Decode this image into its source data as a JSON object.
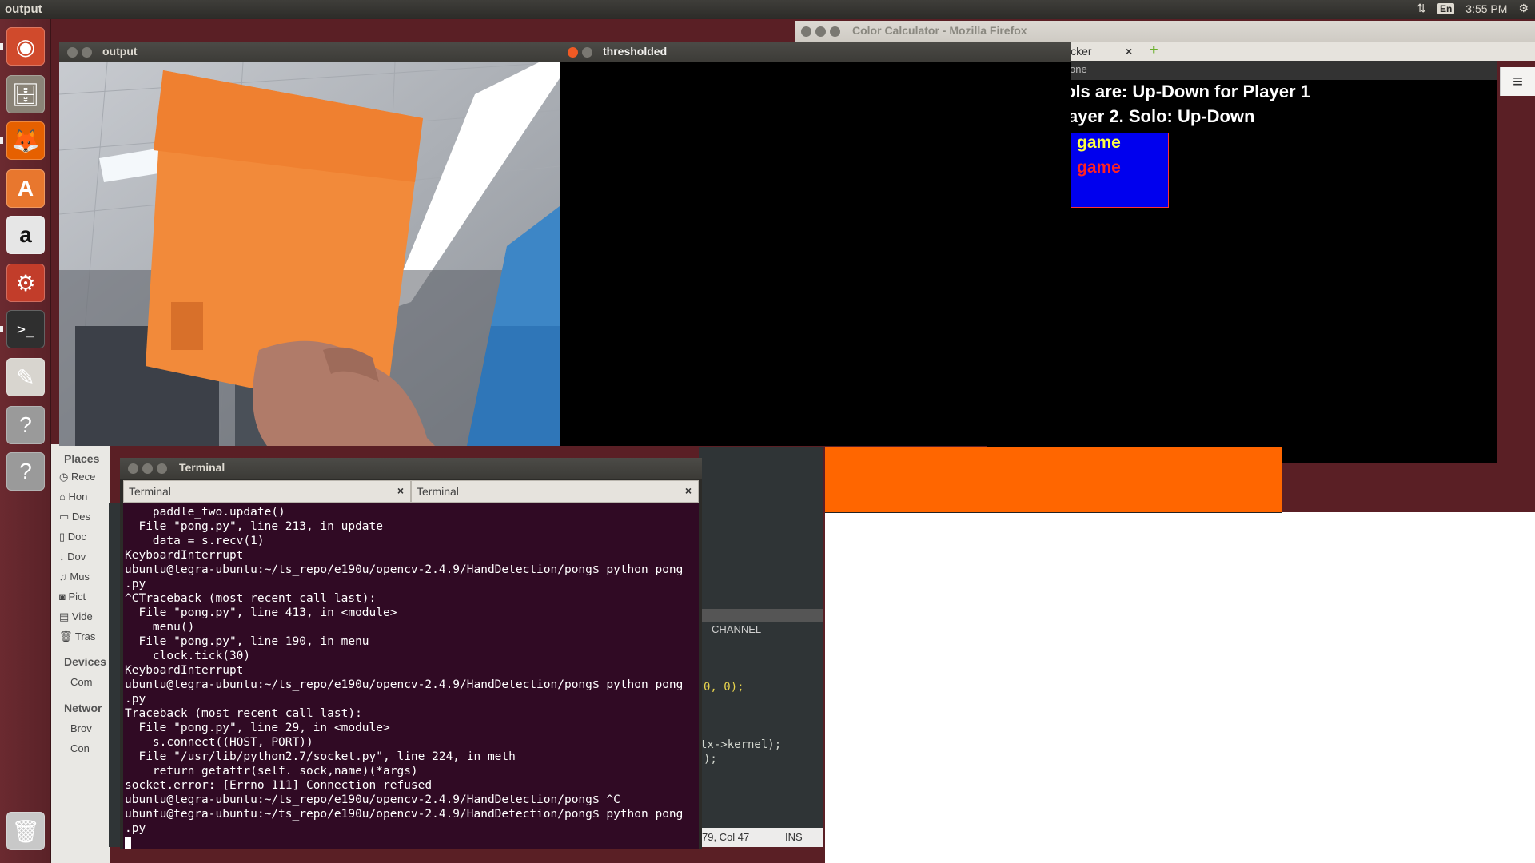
{
  "top_panel": {
    "app_title": "output",
    "keyboard": "En",
    "time": "3:55 PM",
    "icons": [
      "network-arrows-icon",
      "gear-icon"
    ]
  },
  "launcher": {
    "items": [
      {
        "name": "ubuntu-dash",
        "glyph": "◉",
        "color": "#d04a2c"
      },
      {
        "name": "files",
        "glyph": "🗄",
        "color": "#8a8377"
      },
      {
        "name": "firefox",
        "glyph": "🦊",
        "color": "#e66000"
      },
      {
        "name": "software-center",
        "glyph": "A",
        "color": "#e8772e"
      },
      {
        "name": "amazon",
        "glyph": "a",
        "color": "#e6e6e6"
      },
      {
        "name": "system-settings",
        "glyph": "⚙",
        "color": "#c23d2a"
      },
      {
        "name": "terminal",
        "glyph": ">_",
        "color": "#2f2f2f"
      },
      {
        "name": "text-editor",
        "glyph": "✎",
        "color": "#d8d5cf"
      },
      {
        "name": "unknown-app-1",
        "glyph": "?",
        "color": "#9a9a9a"
      },
      {
        "name": "unknown-app-2",
        "glyph": "?",
        "color": "#9a9a9a"
      },
      {
        "name": "trash",
        "glyph": "🗑",
        "color": "#c8c8c8"
      }
    ]
  },
  "output_window": {
    "title": "output"
  },
  "thresholded_window": {
    "title": "thresholded"
  },
  "firefox": {
    "title": "Color Calculator - Mozilla Firefox",
    "tab_label": "icker",
    "tab_close": "×",
    "new_tab": "+",
    "strip_text": "one"
  },
  "game": {
    "line1": "ols are: Up-Down for Player 1",
    "line2": "ayer 2. Solo: Up-Down",
    "option1": "game",
    "option2": "game",
    "option1_color": "#ffff44",
    "option2_color": "#ff2222"
  },
  "editor": {
    "channel": "CHANNEL",
    "code1": "0, 0);",
    "code2": "tx->kernel);",
    "code3": ");",
    "status_pos": "79, Col 47",
    "status_mode": "INS"
  },
  "nautilus": {
    "places_heading": "Places",
    "places": [
      "Rece",
      "Hon",
      "Des",
      "Doc",
      "Dov",
      "Mus",
      "Pict",
      "Vide",
      "Tras"
    ],
    "devices_heading": "Devices",
    "devices": [
      "Com"
    ],
    "network_heading": "Networ",
    "network": [
      "Brov",
      "Con"
    ]
  },
  "terminal": {
    "title": "Terminal",
    "tabs": [
      "Terminal",
      "Terminal"
    ],
    "tab_close": "×",
    "lines": [
      "    paddle_two.update()",
      "  File \"pong.py\", line 213, in update",
      "    data = s.recv(1)",
      "KeyboardInterrupt",
      "ubuntu@tegra-ubuntu:~/ts_repo/e190u/opencv-2.4.9/HandDetection/pong$ python pong",
      ".py",
      "^CTraceback (most recent call last):",
      "  File \"pong.py\", line 413, in <module>",
      "    menu()",
      "  File \"pong.py\", line 190, in menu",
      "    clock.tick(30)",
      "KeyboardInterrupt",
      "ubuntu@tegra-ubuntu:~/ts_repo/e190u/opencv-2.4.9/HandDetection/pong$ python pong",
      ".py",
      "Traceback (most recent call last):",
      "  File \"pong.py\", line 29, in <module>",
      "    s.connect((HOST, PORT))",
      "  File \"/usr/lib/python2.7/socket.py\", line 224, in meth",
      "    return getattr(self._sock,name)(*args)",
      "socket.error: [Errno 111] Connection refused",
      "ubuntu@tegra-ubuntu:~/ts_repo/e190u/opencv-2.4.9/HandDetection/pong$ ^C",
      "ubuntu@tegra-ubuntu:~/ts_repo/e190u/opencv-2.4.9/HandDetection/pong$ python pong",
      ".py"
    ]
  }
}
